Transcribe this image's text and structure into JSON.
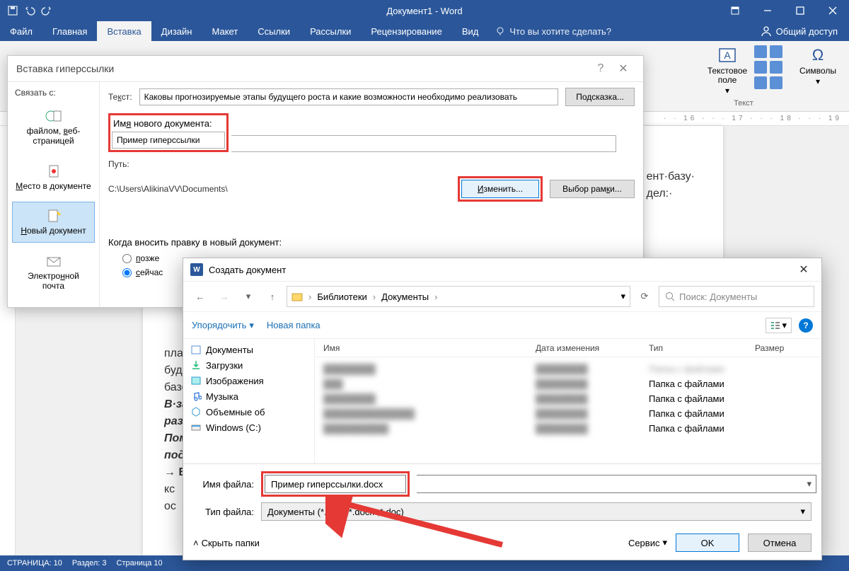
{
  "app": {
    "title": "Документ1 - Word"
  },
  "menu": {
    "file": "Файл",
    "home": "Главная",
    "insert": "Вставка",
    "design": "Дизайн",
    "layout": "Макет",
    "references": "Ссылки",
    "mailings": "Рассылки",
    "review": "Рецензирование",
    "view": "Вид",
    "tell": "Что вы хотите сделать?",
    "share": "Общий доступ"
  },
  "ribbon": {
    "textbox": "Текстовое поле",
    "symbols": "Символы",
    "group_text": "Текст"
  },
  "ruler": "· · 16 · · · 17 · · · 18 · · · 19",
  "doc_lines": {
    "l1": "ент·базу·",
    "l2": "дел:·",
    "l3": "план",
    "l4": "буде",
    "l5": "базо",
    "l6": "В·зае",
    "l7": "разд",
    "l8": "Пом",
    "l9": "подр",
    "l10": "→ В",
    "l11": "кс",
    "l12": "ос"
  },
  "status": {
    "page": "СТРАНИЦА: 10",
    "section": "Раздел: 3",
    "pageof": "Страница 10"
  },
  "hl": {
    "title": "Вставка гиперссылки",
    "link_with": "Связать с:",
    "opt_file": "файлом, веб-страницей",
    "opt_place": "Место в документе",
    "opt_newdoc": "Новый документ",
    "opt_email": "Электронной почта",
    "text_label": "Текст:",
    "text_value": "Каковы прогнозируемые этапы будущего роста и какие возможности необходимо реализовать",
    "tooltip_btn": "Подсказка...",
    "newdoc_label": "Имя нового документа:",
    "newdoc_value": "Пример гиперссылки",
    "path_label": "Путь:",
    "path_value": "C:\\Users\\AlikinaVV\\Documents\\",
    "change_btn": "Изменить...",
    "frame_btn": "Выбор рамки...",
    "when_label": "Когда вносить правку в новый документ:",
    "radio_later": "позже",
    "radio_now": "сейчас"
  },
  "save": {
    "title": "Создать документ",
    "crumb1": "Библиотеки",
    "crumb2": "Документы",
    "search_ph": "Поиск: Документы",
    "organize": "Упорядочить",
    "newfolder": "Новая папка",
    "tree": {
      "docs": "Документы",
      "downloads": "Загрузки",
      "pictures": "Изображения",
      "music": "Музыка",
      "3d": "Объемные об",
      "cdrive": "Windows (C:)"
    },
    "cols": {
      "name": "Имя",
      "date": "Дата изменения",
      "type": "Тип",
      "size": "Размер"
    },
    "type_folder": "Папка с файлами",
    "filename_label": "Имя файла:",
    "filename_value": "Пример гиперссылки.docx",
    "filetype_label": "Тип файла:",
    "filetype_value": "Документы (*.docx;*.docm;*.doc)",
    "hide": "Скрыть папки",
    "service": "Сервис",
    "ok": "OK",
    "cancel": "Отмена"
  }
}
